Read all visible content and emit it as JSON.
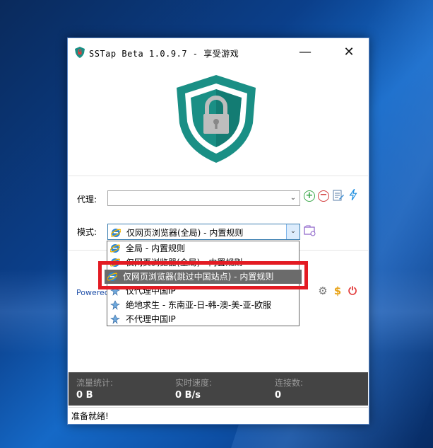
{
  "window": {
    "title": "SSTap Beta 1.0.9.7 - 享受游戏",
    "minimize_glyph": "—",
    "close_glyph": "✕"
  },
  "form": {
    "proxy_label": "代理:",
    "proxy_value": "",
    "mode_label": "模式:",
    "mode_value": "仅网页浏览器(全局) - 内置规则"
  },
  "dropdown": {
    "options": [
      {
        "label": "全局 - 内置规则",
        "icon": "ie-icon"
      },
      {
        "label": "仅网页浏览器(全局) - 内置规则",
        "icon": "ie-icon"
      },
      {
        "label": "仅网页浏览器(跳过中国站点) - 内置规则",
        "icon": "ie-icon",
        "highlighted": true
      },
      {
        "label": "仅代理中国IP",
        "icon": "pubg-icon"
      },
      {
        "label": "绝地求生 - 东南亚-日-韩-澳-美-亚-欧服",
        "icon": "pubg-icon"
      },
      {
        "label": "不代理中国IP",
        "icon": "pubg-icon"
      }
    ]
  },
  "footer": {
    "powered_text": "Powered"
  },
  "stats": {
    "traffic_label": "流量统计:",
    "traffic_value": "0 B",
    "speed_label": "实时速度:",
    "speed_value": "0 B/s",
    "connections_label": "连接数:",
    "connections_value": "0"
  },
  "status": {
    "text": "准备就绪!"
  },
  "colors": {
    "shield_teal": "#1a8f85",
    "highlight_red": "#e31b23",
    "stats_bg": "#444444"
  }
}
